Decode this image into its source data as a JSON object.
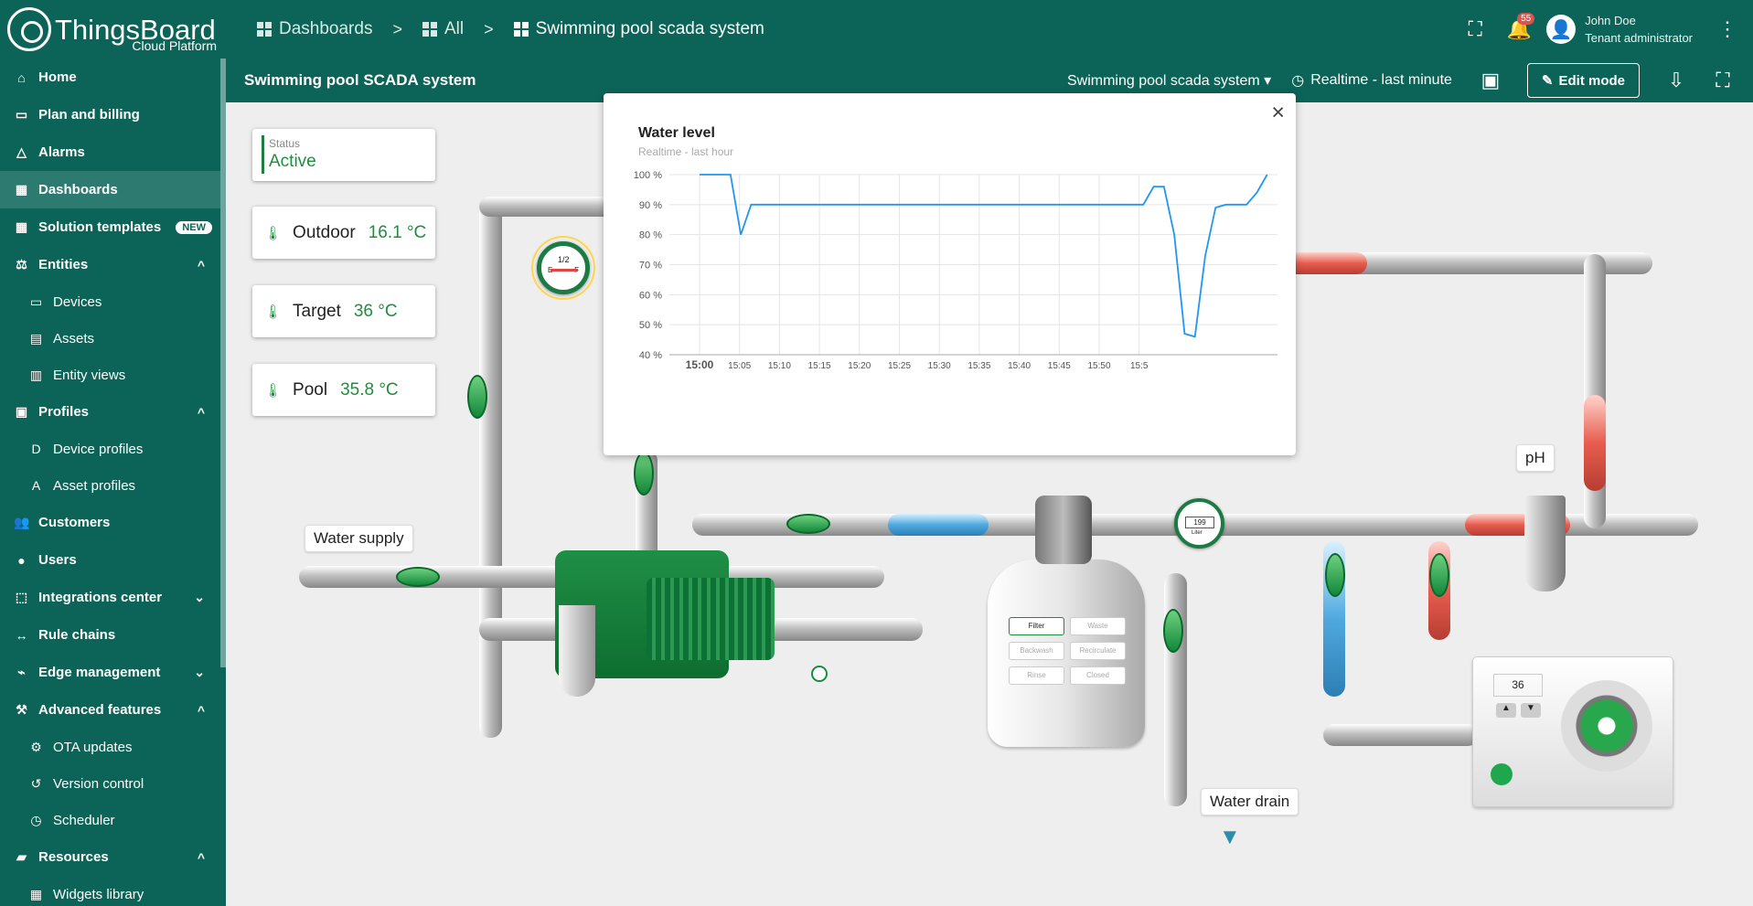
{
  "app": {
    "name": "ThingsBoard",
    "edition": "Cloud Platform"
  },
  "breadcrumb": [
    "Dashboards",
    "All",
    "Swimming pool scada system"
  ],
  "notifications": {
    "count": "55"
  },
  "user": {
    "name": "John Doe",
    "role": "Tenant administrator"
  },
  "sidebar": {
    "items": [
      {
        "label": "Home",
        "icon": "home-icon"
      },
      {
        "label": "Plan and billing",
        "icon": "billing-icon"
      },
      {
        "label": "Alarms",
        "icon": "warning-icon"
      },
      {
        "label": "Dashboards",
        "icon": "dashboard-icon",
        "active": true
      },
      {
        "label": "Solution templates",
        "icon": "apps-icon",
        "badge": "NEW"
      },
      {
        "label": "Entities",
        "icon": "entities-icon",
        "expanded": true
      },
      {
        "label": "Devices",
        "icon": "device-icon",
        "sub": true
      },
      {
        "label": "Assets",
        "icon": "asset-icon",
        "sub": true
      },
      {
        "label": "Entity views",
        "icon": "view-icon",
        "sub": true
      },
      {
        "label": "Profiles",
        "icon": "profile-icon",
        "expanded": true
      },
      {
        "label": "Device profiles",
        "icon": "device-profile-icon",
        "sub": true
      },
      {
        "label": "Asset profiles",
        "icon": "asset-profile-icon",
        "sub": true
      },
      {
        "label": "Customers",
        "icon": "customers-icon"
      },
      {
        "label": "Users",
        "icon": "user-icon"
      },
      {
        "label": "Integrations center",
        "icon": "integration-icon",
        "collapsed": true
      },
      {
        "label": "Rule chains",
        "icon": "rule-chain-icon"
      },
      {
        "label": "Edge management",
        "icon": "edge-icon",
        "collapsed": true
      },
      {
        "label": "Advanced features",
        "icon": "tools-icon",
        "expanded": true
      },
      {
        "label": "OTA updates",
        "icon": "ota-icon",
        "sub": true
      },
      {
        "label": "Version control",
        "icon": "history-icon",
        "sub": true
      },
      {
        "label": "Scheduler",
        "icon": "clock-icon",
        "sub": true
      },
      {
        "label": "Resources",
        "icon": "folder-icon",
        "expanded": true
      },
      {
        "label": "Widgets library",
        "icon": "widgets-icon",
        "sub": true
      }
    ]
  },
  "dashboard": {
    "title": "Swimming pool SCADA system",
    "state": "Swimming pool scada system",
    "timewindow": "Realtime - last minute",
    "edit_label": "Edit mode"
  },
  "widgets": {
    "status_label": "Status",
    "status_value": "Active",
    "outdoor_label": "Outdoor",
    "outdoor_value": "16.1 °C",
    "target_label": "Target",
    "target_value": "36 °C",
    "pool_label": "Pool",
    "pool_value": "35.8 °C",
    "water_supply": "Water supply",
    "water_drain": "Water drain",
    "ph": "pH",
    "gauge": {
      "half": "1/2",
      "empty": "E",
      "full": "F"
    },
    "meter_value": "199",
    "meter_unit": "Liter",
    "filter_modes": [
      "Filter",
      "Waste",
      "Backwash",
      "Recirculate",
      "Rinse",
      "Closed"
    ],
    "heater_setpoint": "36"
  },
  "popup": {
    "title": "Water level",
    "subtitle": "Realtime - last hour"
  },
  "chart_data": {
    "type": "line",
    "title": "Water level",
    "subtitle": "Realtime - last hour",
    "x": [
      "15:00",
      "15:01",
      "15:02",
      "15:03",
      "15:04",
      "15:05",
      "15:10",
      "15:15",
      "15:20",
      "15:25",
      "15:30",
      "15:35",
      "15:36",
      "15:40",
      "15:41",
      "15:43",
      "15:44",
      "15:45",
      "15:46",
      "15:47",
      "15:48",
      "15:49",
      "15:50",
      "15:51",
      "15:52",
      "15:53",
      "15:54",
      "15:55"
    ],
    "series": [
      {
        "values": [
          100,
          100,
          100,
          100,
          80,
          90,
          90,
          90,
          90,
          90,
          90,
          90,
          90,
          90,
          90,
          90,
          96,
          96,
          80,
          47,
          46,
          73,
          89,
          90,
          90,
          90,
          94,
          100
        ]
      }
    ],
    "tick_labels": [
      "15:00",
      "15:05",
      "15:10",
      "15:15",
      "15:20",
      "15:25",
      "15:30",
      "15:35",
      "15:40",
      "15:45",
      "15:50",
      "15:5"
    ],
    "y_tick_labels": [
      "100 %",
      "90 %",
      "80 %",
      "70 %",
      "60 %",
      "50 %",
      "40 %"
    ],
    "ylim": [
      40,
      100
    ],
    "grid": true,
    "color": "#2196f3"
  }
}
